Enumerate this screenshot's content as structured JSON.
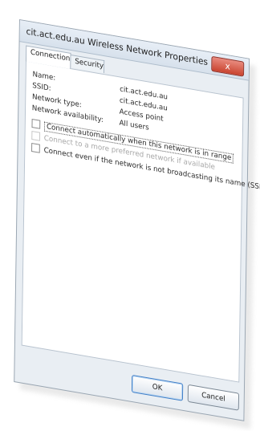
{
  "window": {
    "title": "cit.act.edu.au Wireless Network Properties",
    "close_symbol": "x"
  },
  "tabs": [
    {
      "label": "Connection"
    },
    {
      "label": "Security"
    }
  ],
  "properties": {
    "name": {
      "label": "Name:",
      "value": "cit.act.edu.au"
    },
    "ssid": {
      "label": "SSID:",
      "value": "cit.act.edu.au"
    },
    "network_type": {
      "label": "Network type:",
      "value": "Access point"
    },
    "availability": {
      "label": "Network availability:",
      "value": "All users"
    }
  },
  "options": {
    "auto_connect": {
      "label": "Connect automatically when this network is in range",
      "checked": false
    },
    "prefer_network": {
      "label": "Connect to a more preferred network if available",
      "checked": false
    },
    "hidden_ssid": {
      "label": "Connect even if the network is not broadcasting its name (SSID)",
      "checked": false
    }
  },
  "buttons": {
    "ok": "OK",
    "cancel": "Cancel"
  }
}
